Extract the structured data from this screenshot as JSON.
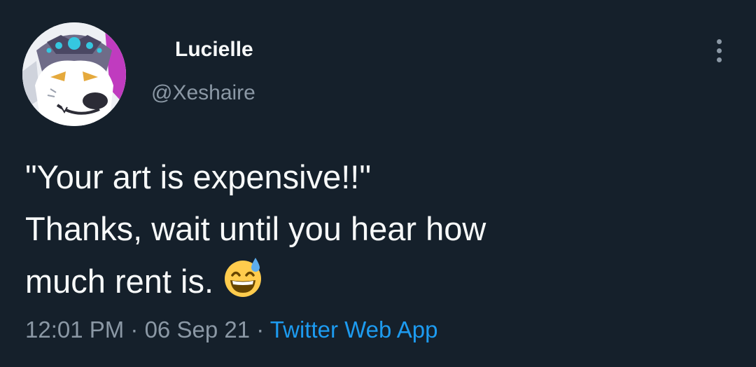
{
  "author": {
    "display_name": "Lucielle",
    "handle": "@Xeshaire",
    "name_decoration_icon": "crescent-moon-icon",
    "avatar_icon": "wolf-avatar-icon"
  },
  "menu": {
    "icon": "more-options-icon"
  },
  "tweet": {
    "lines": [
      "\"Your art is expensive!!\"",
      "Thanks, wait until you hear how",
      "much rent is."
    ],
    "emoji_icon": "grinning-sweat-emoji-icon"
  },
  "meta": {
    "time": "12:01 PM",
    "separator": " · ",
    "date": "06 Sep 21",
    "source": "Twitter Web App"
  },
  "colors": {
    "background": "#15202b",
    "text_primary": "#f7f9f9",
    "text_secondary": "#8b98a5",
    "link": "#1d9bf0",
    "moon": "#f4d77a"
  }
}
